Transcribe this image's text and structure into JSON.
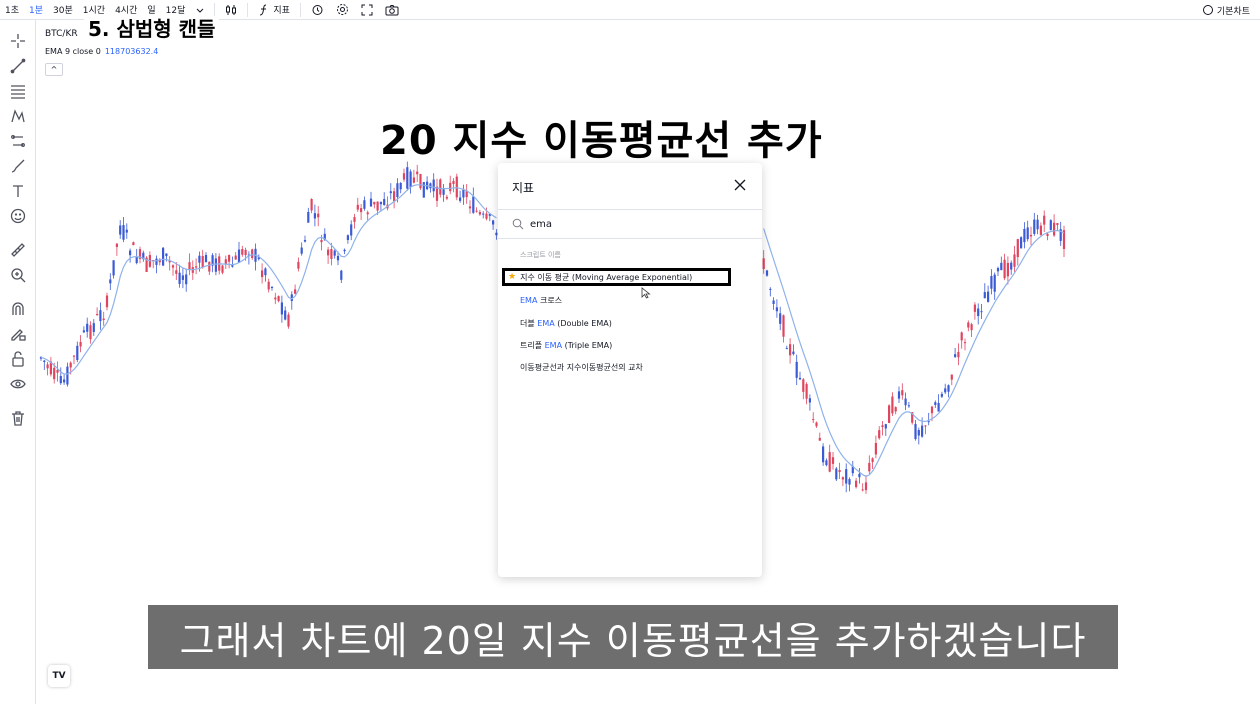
{
  "topbar": {
    "timeframes": [
      "1초",
      "1분",
      "30분",
      "1시간",
      "4시간",
      "일",
      "12달"
    ],
    "active_timeframe": "1분",
    "indicators_label": "지표",
    "chart_style_label": "기본차트"
  },
  "chart": {
    "symbol": "BTC/KR",
    "ema_legend": "EMA 9 close 0",
    "ema_value": "118703632.4",
    "collapse_label": "^",
    "logo_text": "TV",
    "up_color": "#e0455f",
    "down_color": "#3a5ad6",
    "ema_color": "#8fb2ea"
  },
  "overlay": {
    "section_title": "5. 삼법형 캔들",
    "main_caption": "20 지수 이동평균선 추가",
    "subtitle": "그래서 차트에 20일 지수 이동평균선을 추가하겠습니다"
  },
  "dialog": {
    "title": "지표",
    "search_value": "ema",
    "section_label": "스크립트 이름",
    "results": [
      {
        "text": "지수 이동 평균 (Moving Average Exponential)",
        "starred": true
      },
      {
        "pre": "",
        "hl": "EMA",
        "post": " 크로스"
      },
      {
        "pre": "더블 ",
        "hl": "EMA",
        "post": " (Double EMA)"
      },
      {
        "pre": "트리플 ",
        "hl": "EMA",
        "post": " (Triple EMA)"
      },
      {
        "pre": "이동평균선과 지수이동평균선의 교차",
        "hl": "",
        "post": ""
      }
    ]
  }
}
